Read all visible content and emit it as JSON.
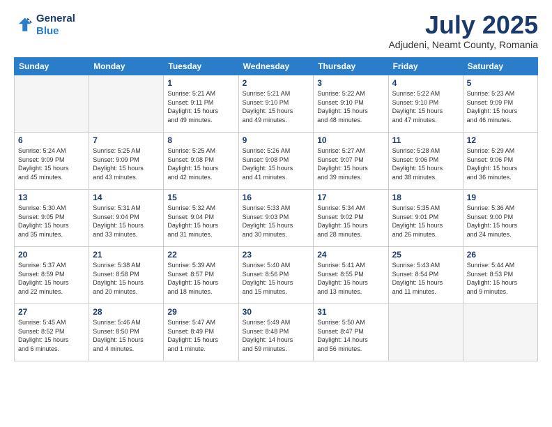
{
  "logo": {
    "line1": "General",
    "line2": "Blue"
  },
  "title": "July 2025",
  "location": "Adjudeni, Neamt County, Romania",
  "headers": [
    "Sunday",
    "Monday",
    "Tuesday",
    "Wednesday",
    "Thursday",
    "Friday",
    "Saturday"
  ],
  "weeks": [
    [
      {
        "day": "",
        "info": ""
      },
      {
        "day": "",
        "info": ""
      },
      {
        "day": "1",
        "info": "Sunrise: 5:21 AM\nSunset: 9:11 PM\nDaylight: 15 hours\nand 49 minutes."
      },
      {
        "day": "2",
        "info": "Sunrise: 5:21 AM\nSunset: 9:10 PM\nDaylight: 15 hours\nand 49 minutes."
      },
      {
        "day": "3",
        "info": "Sunrise: 5:22 AM\nSunset: 9:10 PM\nDaylight: 15 hours\nand 48 minutes."
      },
      {
        "day": "4",
        "info": "Sunrise: 5:22 AM\nSunset: 9:10 PM\nDaylight: 15 hours\nand 47 minutes."
      },
      {
        "day": "5",
        "info": "Sunrise: 5:23 AM\nSunset: 9:09 PM\nDaylight: 15 hours\nand 46 minutes."
      }
    ],
    [
      {
        "day": "6",
        "info": "Sunrise: 5:24 AM\nSunset: 9:09 PM\nDaylight: 15 hours\nand 45 minutes."
      },
      {
        "day": "7",
        "info": "Sunrise: 5:25 AM\nSunset: 9:09 PM\nDaylight: 15 hours\nand 43 minutes."
      },
      {
        "day": "8",
        "info": "Sunrise: 5:25 AM\nSunset: 9:08 PM\nDaylight: 15 hours\nand 42 minutes."
      },
      {
        "day": "9",
        "info": "Sunrise: 5:26 AM\nSunset: 9:08 PM\nDaylight: 15 hours\nand 41 minutes."
      },
      {
        "day": "10",
        "info": "Sunrise: 5:27 AM\nSunset: 9:07 PM\nDaylight: 15 hours\nand 39 minutes."
      },
      {
        "day": "11",
        "info": "Sunrise: 5:28 AM\nSunset: 9:06 PM\nDaylight: 15 hours\nand 38 minutes."
      },
      {
        "day": "12",
        "info": "Sunrise: 5:29 AM\nSunset: 9:06 PM\nDaylight: 15 hours\nand 36 minutes."
      }
    ],
    [
      {
        "day": "13",
        "info": "Sunrise: 5:30 AM\nSunset: 9:05 PM\nDaylight: 15 hours\nand 35 minutes."
      },
      {
        "day": "14",
        "info": "Sunrise: 5:31 AM\nSunset: 9:04 PM\nDaylight: 15 hours\nand 33 minutes."
      },
      {
        "day": "15",
        "info": "Sunrise: 5:32 AM\nSunset: 9:04 PM\nDaylight: 15 hours\nand 31 minutes."
      },
      {
        "day": "16",
        "info": "Sunrise: 5:33 AM\nSunset: 9:03 PM\nDaylight: 15 hours\nand 30 minutes."
      },
      {
        "day": "17",
        "info": "Sunrise: 5:34 AM\nSunset: 9:02 PM\nDaylight: 15 hours\nand 28 minutes."
      },
      {
        "day": "18",
        "info": "Sunrise: 5:35 AM\nSunset: 9:01 PM\nDaylight: 15 hours\nand 26 minutes."
      },
      {
        "day": "19",
        "info": "Sunrise: 5:36 AM\nSunset: 9:00 PM\nDaylight: 15 hours\nand 24 minutes."
      }
    ],
    [
      {
        "day": "20",
        "info": "Sunrise: 5:37 AM\nSunset: 8:59 PM\nDaylight: 15 hours\nand 22 minutes."
      },
      {
        "day": "21",
        "info": "Sunrise: 5:38 AM\nSunset: 8:58 PM\nDaylight: 15 hours\nand 20 minutes."
      },
      {
        "day": "22",
        "info": "Sunrise: 5:39 AM\nSunset: 8:57 PM\nDaylight: 15 hours\nand 18 minutes."
      },
      {
        "day": "23",
        "info": "Sunrise: 5:40 AM\nSunset: 8:56 PM\nDaylight: 15 hours\nand 15 minutes."
      },
      {
        "day": "24",
        "info": "Sunrise: 5:41 AM\nSunset: 8:55 PM\nDaylight: 15 hours\nand 13 minutes."
      },
      {
        "day": "25",
        "info": "Sunrise: 5:43 AM\nSunset: 8:54 PM\nDaylight: 15 hours\nand 11 minutes."
      },
      {
        "day": "26",
        "info": "Sunrise: 5:44 AM\nSunset: 8:53 PM\nDaylight: 15 hours\nand 9 minutes."
      }
    ],
    [
      {
        "day": "27",
        "info": "Sunrise: 5:45 AM\nSunset: 8:52 PM\nDaylight: 15 hours\nand 6 minutes."
      },
      {
        "day": "28",
        "info": "Sunrise: 5:46 AM\nSunset: 8:50 PM\nDaylight: 15 hours\nand 4 minutes."
      },
      {
        "day": "29",
        "info": "Sunrise: 5:47 AM\nSunset: 8:49 PM\nDaylight: 15 hours\nand 1 minute."
      },
      {
        "day": "30",
        "info": "Sunrise: 5:49 AM\nSunset: 8:48 PM\nDaylight: 14 hours\nand 59 minutes."
      },
      {
        "day": "31",
        "info": "Sunrise: 5:50 AM\nSunset: 8:47 PM\nDaylight: 14 hours\nand 56 minutes."
      },
      {
        "day": "",
        "info": ""
      },
      {
        "day": "",
        "info": ""
      }
    ]
  ]
}
